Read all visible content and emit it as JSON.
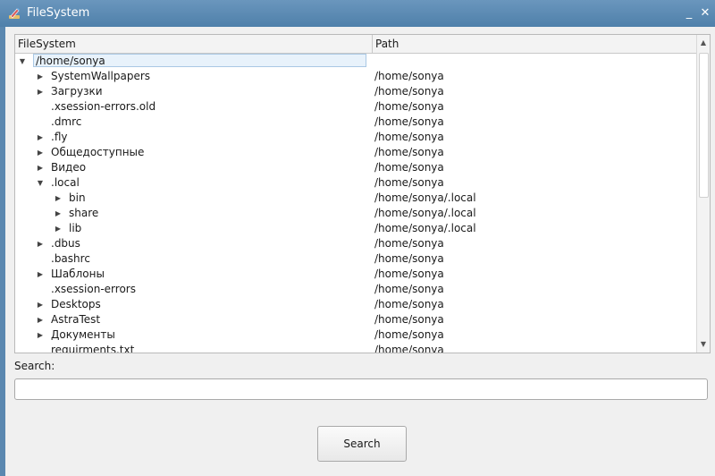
{
  "window": {
    "title": "FileSystem",
    "minimize_glyph": "_",
    "close_glyph": "✕"
  },
  "tree": {
    "columns": [
      "FileSystem",
      "Path"
    ],
    "rows": [
      {
        "name": "/home/sonya",
        "path": "",
        "level": 0,
        "arrow": "expanded",
        "selected": true
      },
      {
        "name": "SystemWallpapers",
        "path": "/home/sonya",
        "level": 1,
        "arrow": "collapsed"
      },
      {
        "name": "Загрузки",
        "path": "/home/sonya",
        "level": 1,
        "arrow": "collapsed"
      },
      {
        "name": ".xsession-errors.old",
        "path": "/home/sonya",
        "level": 1,
        "arrow": "none"
      },
      {
        "name": ".dmrc",
        "path": "/home/sonya",
        "level": 1,
        "arrow": "none"
      },
      {
        "name": ".fly",
        "path": "/home/sonya",
        "level": 1,
        "arrow": "collapsed"
      },
      {
        "name": "Общедоступные",
        "path": "/home/sonya",
        "level": 1,
        "arrow": "collapsed"
      },
      {
        "name": "Видео",
        "path": "/home/sonya",
        "level": 1,
        "arrow": "collapsed"
      },
      {
        "name": ".local",
        "path": "/home/sonya",
        "level": 1,
        "arrow": "expanded"
      },
      {
        "name": "bin",
        "path": "/home/sonya/.local",
        "level": 2,
        "arrow": "collapsed"
      },
      {
        "name": "share",
        "path": "/home/sonya/.local",
        "level": 2,
        "arrow": "collapsed"
      },
      {
        "name": "lib",
        "path": "/home/sonya/.local",
        "level": 2,
        "arrow": "collapsed"
      },
      {
        "name": ".dbus",
        "path": "/home/sonya",
        "level": 1,
        "arrow": "collapsed"
      },
      {
        "name": ".bashrc",
        "path": "/home/sonya",
        "level": 1,
        "arrow": "none"
      },
      {
        "name": "Шаблоны",
        "path": "/home/sonya",
        "level": 1,
        "arrow": "collapsed"
      },
      {
        "name": ".xsession-errors",
        "path": "/home/sonya",
        "level": 1,
        "arrow": "none"
      },
      {
        "name": "Desktops",
        "path": "/home/sonya",
        "level": 1,
        "arrow": "collapsed"
      },
      {
        "name": "AstraTest",
        "path": "/home/sonya",
        "level": 1,
        "arrow": "collapsed"
      },
      {
        "name": "Документы",
        "path": "/home/sonya",
        "level": 1,
        "arrow": "collapsed"
      },
      {
        "name": "requirments.txt",
        "path": "/home/sonya",
        "level": 1,
        "arrow": "none"
      }
    ]
  },
  "search": {
    "label": "Search:",
    "value": "",
    "placeholder": "",
    "button_label": "Search"
  },
  "icons": {
    "app": "app-pencil-icon",
    "expanded": "triangle-down-icon",
    "collapsed": "triangle-right-icon",
    "scroll_up": "scroll-up-arrow-icon",
    "scroll_down": "scroll-down-arrow-icon"
  }
}
